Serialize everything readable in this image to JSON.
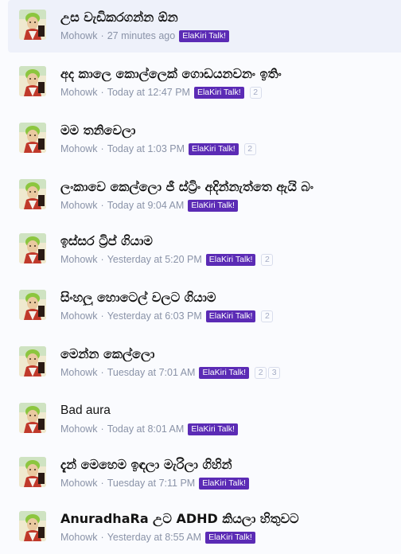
{
  "threads": [
    {
      "title": "උස වැඩිකරගන්න ඕන",
      "author": "Mohowk",
      "sep": "·",
      "time": "27 minutes ago",
      "prefix": "ElaKiri Talk!",
      "pages": []
    },
    {
      "title": "අද කාලෙ කොල්ලෙක් ගොඩයනවනං ඉතිං",
      "author": "Mohowk",
      "sep": "·",
      "time": "Today at 12:47 PM",
      "prefix": "ElaKiri Talk!",
      "pages": [
        "2"
      ]
    },
    {
      "title": "මම තනිවෙලා",
      "author": "Mohowk",
      "sep": "·",
      "time": "Today at 1:03 PM",
      "prefix": "ElaKiri Talk!",
      "pages": [
        "2"
      ]
    },
    {
      "title": "ලංකාවෙ කෙල්ලො ජී ස්ට්‍රිං අදින්නැත්තෙ ඇයි බං",
      "author": "Mohowk",
      "sep": "·",
      "time": "Today at 9:04 AM",
      "prefix": "ElaKiri Talk!",
      "pages": []
    },
    {
      "title": "ඉස්සර ට්‍රිප් ගියාම",
      "author": "Mohowk",
      "sep": "·",
      "time": "Yesterday at 5:20 PM",
      "prefix": "ElaKiri Talk!",
      "pages": [
        "2"
      ]
    },
    {
      "title": "සිංහලු හොටෙල් වලට ගියාම",
      "author": "Mohowk",
      "sep": "·",
      "time": "Yesterday at 6:03 PM",
      "prefix": "ElaKiri Talk!",
      "pages": [
        "2"
      ]
    },
    {
      "title": "මෙන්න කෙල්ලො",
      "author": "Mohowk",
      "sep": "·",
      "time": "Tuesday at 7:01 AM",
      "prefix": "ElaKiri Talk!",
      "pages": [
        "2",
        "3"
      ]
    },
    {
      "title": "Bad aura",
      "author": "Mohowk",
      "sep": "·",
      "time": "Today at 8:01 AM",
      "prefix": "ElaKiri Talk!",
      "pages": []
    },
    {
      "title": "දැන් මෙහෙම ඉඳලා මැරිලා ගිහින්",
      "author": "Mohowk",
      "sep": "·",
      "time": "Tuesday at 7:11 PM",
      "prefix": "ElaKiri Talk!",
      "pages": []
    },
    {
      "title": "AnuradhaRa උට ADHD කියලා හිතුවට",
      "author": "Mohowk",
      "sep": "·",
      "time": "Yesterday at 8:55 AM",
      "prefix": "ElaKiri Talk!",
      "pages": []
    }
  ],
  "colors": {
    "prefix_badge": "#5b2bb5",
    "meta_text": "#8a93a8",
    "title_text": "#141414",
    "current_row": "#eef1fa"
  },
  "icons": {
    "avatar": "avatar-image"
  }
}
